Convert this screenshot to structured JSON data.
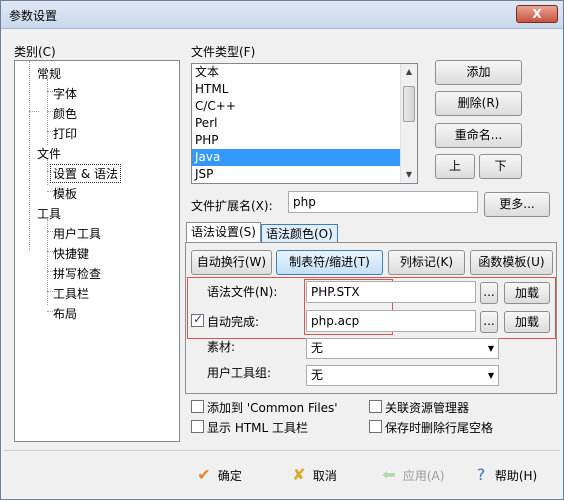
{
  "window": {
    "title": "参数设置",
    "close_label": "X"
  },
  "category": {
    "label": "类别(C)",
    "tree": [
      {
        "label": "常规",
        "level": 0
      },
      {
        "label": "字体",
        "level": 1
      },
      {
        "label": "颜色",
        "level": 1
      },
      {
        "label": "打印",
        "level": 1
      },
      {
        "label": "文件",
        "level": 0
      },
      {
        "label": "设置 & 语法",
        "level": 1,
        "selected": true
      },
      {
        "label": "模板",
        "level": 1
      },
      {
        "label": "工具",
        "level": 0
      },
      {
        "label": "用户工具",
        "level": 1
      },
      {
        "label": "快捷键",
        "level": 1
      },
      {
        "label": "拼写检查",
        "level": 1
      },
      {
        "label": "工具栏",
        "level": 1
      },
      {
        "label": "布局",
        "level": 1
      }
    ]
  },
  "filetypes": {
    "label": "文件类型(F)",
    "items": [
      "文本",
      "HTML",
      "C/C++",
      "Perl",
      "PHP",
      "Java",
      "JSP"
    ],
    "selected": "Java"
  },
  "side_buttons": {
    "add": "添加",
    "delete": "删除(R)",
    "rename": "重命名...",
    "up": "上",
    "down": "下"
  },
  "ext": {
    "label": "文件扩展名(X):",
    "value": "php",
    "more": "更多..."
  },
  "tabs": {
    "syntax_settings": "语法设置(S)",
    "syntax_colors": "语法颜色(O)"
  },
  "panel_buttons": {
    "auto_wrap": "自动换行(W)",
    "tab_indent": "制表符/缩进(T)",
    "column_marks": "列标记(K)",
    "func_template": "函数模板(U)"
  },
  "syntax_file": {
    "label": "语法文件(N):",
    "value": "PHP.STX",
    "browse": "...",
    "load": "加载"
  },
  "autocomplete": {
    "label": "自动完成:",
    "value": "php.acp",
    "browse": "...",
    "load": "加载",
    "checked": true
  },
  "material": {
    "label": "素材:",
    "value": "无"
  },
  "user_toolgroup": {
    "label": "用户工具组:",
    "value": "无"
  },
  "options": {
    "add_common": "添加到 'Common Files'",
    "assoc_explorer": "关联资源管理器",
    "show_html_toolbar": "显示 HTML 工具栏",
    "trim_on_save": "保存时删除行尾空格"
  },
  "footer": {
    "ok": "确定",
    "cancel": "取消",
    "apply": "应用(A)",
    "help": "帮助(H)"
  },
  "colors": {
    "selection": "#3399ff",
    "highlight_border": "#d9534f"
  }
}
